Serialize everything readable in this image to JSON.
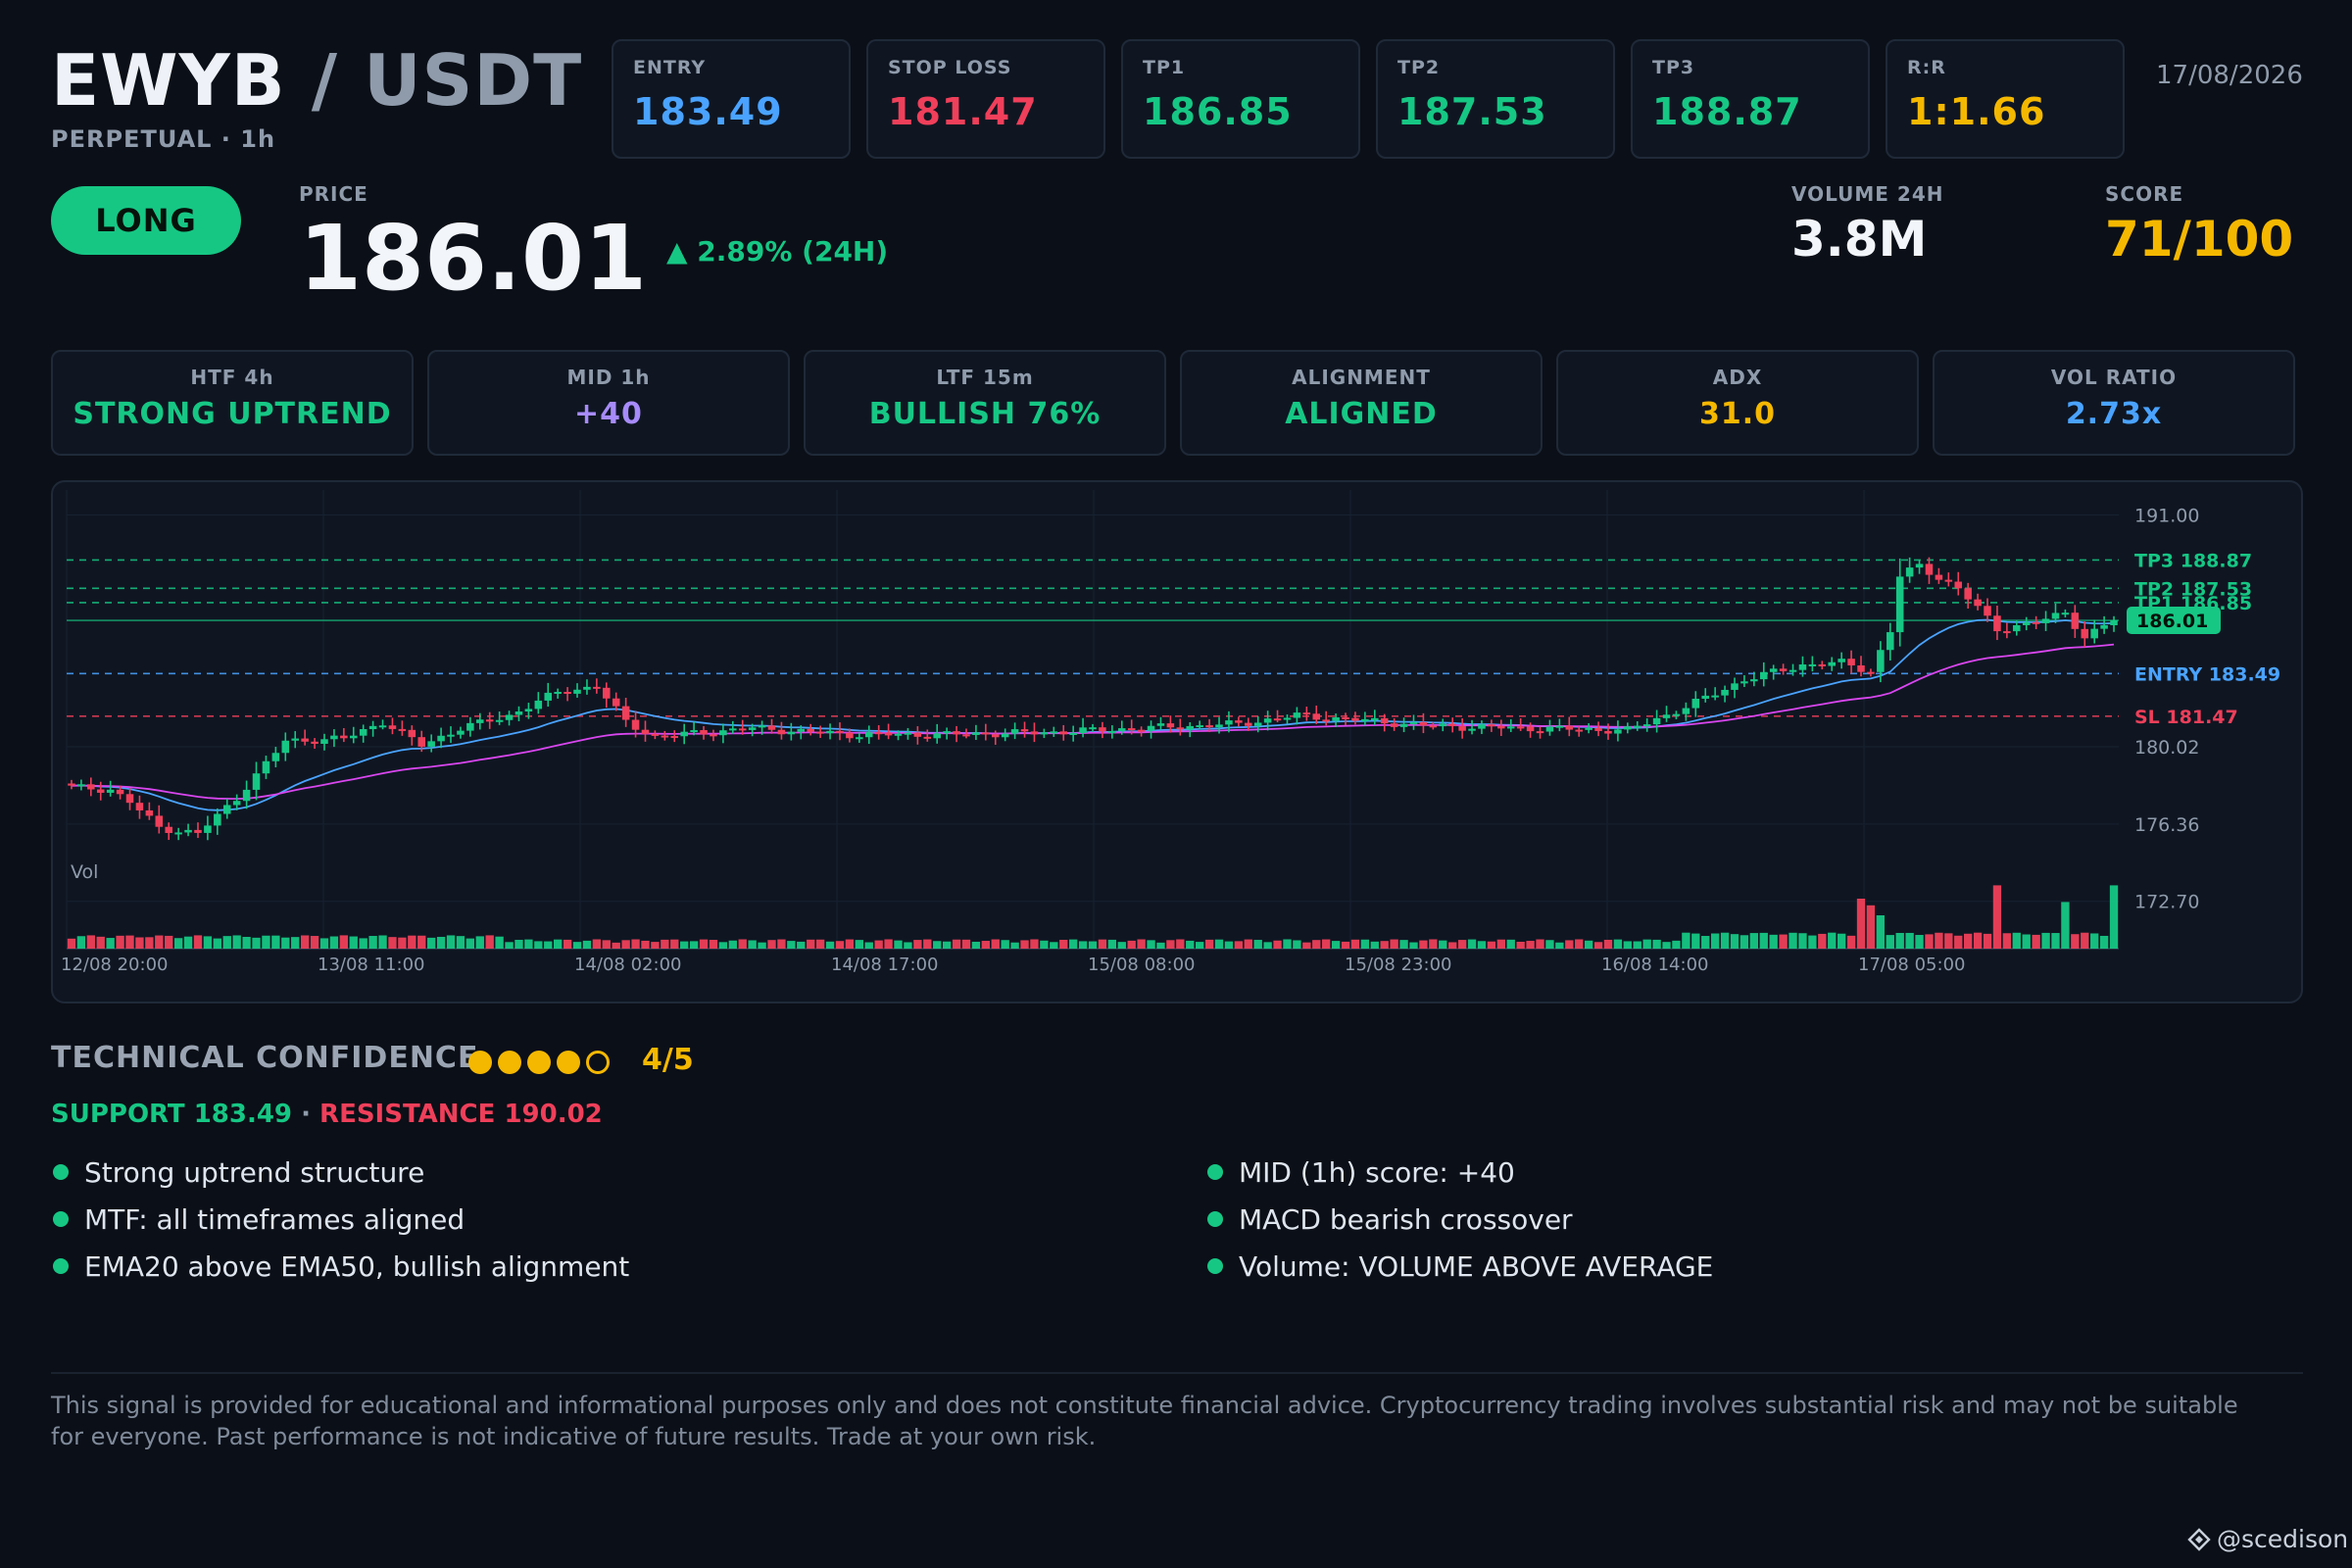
{
  "header": {
    "base": "EWYB",
    "separator": "/",
    "quote": "USDT",
    "subtitle": "PERPETUAL · 1h",
    "date": "17/08/2026"
  },
  "stats": [
    {
      "label": "ENTRY",
      "value": "183.49",
      "color": "#4aa3ff"
    },
    {
      "label": "STOP LOSS",
      "value": "181.47",
      "color": "#ef3f5a"
    },
    {
      "label": "TP1",
      "value": "186.85",
      "color": "#16c784"
    },
    {
      "label": "TP2",
      "value": "187.53",
      "color": "#16c784"
    },
    {
      "label": "TP3",
      "value": "188.87",
      "color": "#16c784"
    },
    {
      "label": "R:R",
      "value": "1:1.66",
      "color": "#f5b800"
    }
  ],
  "signal": {
    "direction": "LONG",
    "price_label": "PRICE",
    "price": "186.01",
    "change": "▲ 2.89% (24H)",
    "volume_label": "VOLUME 24H",
    "volume": "3.8M",
    "score_label": "SCORE",
    "score": "71/100"
  },
  "indicators": [
    {
      "label": "HTF 4h",
      "value": "STRONG UPTREND",
      "color": "#16c784"
    },
    {
      "label": "MID 1h",
      "value": "+40",
      "color": "#a78bfa"
    },
    {
      "label": "LTF 15m",
      "value": "BULLISH 76%",
      "color": "#16c784"
    },
    {
      "label": "ALIGNMENT",
      "value": "ALIGNED",
      "color": "#16c784"
    },
    {
      "label": "ADX",
      "value": "31.0",
      "color": "#f5b800"
    },
    {
      "label": "VOL RATIO",
      "value": "2.73x",
      "color": "#4aa3ff"
    }
  ],
  "chart_data": {
    "type": "candlestick",
    "ylim": [
      171.2,
      192.0
    ],
    "y_ticks": [
      "191.00",
      "180.02",
      "176.36",
      "172.70"
    ],
    "x_labels": [
      "12/08 20:00",
      "13/08 11:00",
      "14/08 02:00",
      "14/08 17:00",
      "15/08 08:00",
      "15/08 23:00",
      "16/08 14:00",
      "17/08 05:00"
    ],
    "volume_label": "Vol",
    "levels": [
      {
        "name": "TP3",
        "label": "TP3 188.87",
        "value": 188.87,
        "color": "#16c784"
      },
      {
        "name": "TP2",
        "label": "TP2 187.53",
        "value": 187.53,
        "color": "#16c784"
      },
      {
        "name": "TP1",
        "label": "TP1 186.85",
        "value": 186.85,
        "color": "#16c784"
      },
      {
        "name": "ENTRY",
        "label": "ENTRY 183.49",
        "value": 183.49,
        "color": "#4aa3ff"
      },
      {
        "name": "SL",
        "label": "SL 181.47",
        "value": 181.47,
        "color": "#ef3f5a"
      }
    ],
    "last_price": {
      "label": "186.01",
      "value": 186.01
    },
    "close_anchors": [
      [
        0,
        178.1
      ],
      [
        4,
        178.0
      ],
      [
        6,
        177.4
      ],
      [
        9,
        176.2
      ],
      [
        13,
        175.9
      ],
      [
        17,
        177.6
      ],
      [
        22,
        180.3
      ],
      [
        28,
        180.4
      ],
      [
        32,
        181.2
      ],
      [
        36,
        180.1
      ],
      [
        40,
        180.9
      ],
      [
        45,
        181.5
      ],
      [
        50,
        182.6
      ],
      [
        54,
        182.9
      ],
      [
        57,
        181.2
      ],
      [
        60,
        180.5
      ],
      [
        70,
        180.9
      ],
      [
        80,
        180.6
      ],
      [
        90,
        180.6
      ],
      [
        100,
        180.7
      ],
      [
        110,
        180.9
      ],
      [
        120,
        181.1
      ],
      [
        126,
        181.5
      ],
      [
        132,
        181.3
      ],
      [
        140,
        181.0
      ],
      [
        150,
        180.9
      ],
      [
        160,
        180.8
      ],
      [
        166,
        181.9
      ],
      [
        172,
        183.2
      ],
      [
        178,
        183.9
      ],
      [
        182,
        184.0
      ],
      [
        185,
        183.6
      ],
      [
        187,
        185.5
      ],
      [
        188,
        188.1
      ],
      [
        190,
        188.6
      ],
      [
        194,
        187.5
      ],
      [
        196,
        186.6
      ],
      [
        198,
        185.6
      ],
      [
        202,
        185.9
      ],
      [
        205,
        186.4
      ],
      [
        207,
        185.2
      ],
      [
        210,
        186.01
      ]
    ],
    "volume_spikes": {
      "184": 0.75,
      "185": 0.65,
      "186": 0.5,
      "198": 0.95,
      "205": 0.7,
      "210": 0.95
    }
  },
  "confidence": {
    "title": "TECHNICAL CONFIDENCE",
    "score": "4/5",
    "filled": 4,
    "total": 5,
    "support": "SUPPORT 183.49",
    "dot": "·",
    "resistance": "RESISTANCE 190.02"
  },
  "bullets_left": [
    "Strong uptrend structure",
    "MTF: all timeframes aligned",
    "EMA20 above EMA50, bullish alignment"
  ],
  "bullets_right": [
    "MID (1h) score: +40",
    "MACD bearish crossover",
    "Volume: VOLUME ABOVE AVERAGE"
  ],
  "disclaimer": "This signal is provided for educational and informational purposes only and does not constitute financial advice. Cryptocurrency trading involves substantial risk and may not be suitable for everyone. Past performance is not indicative of future results. Trade at your own risk.",
  "watermark": "@scedison",
  "colors": {
    "up": "#16c784",
    "down": "#ef3f5a",
    "ema20": "#4aa3ff",
    "ema50": "#d946ef",
    "accent": "#f5b800"
  }
}
